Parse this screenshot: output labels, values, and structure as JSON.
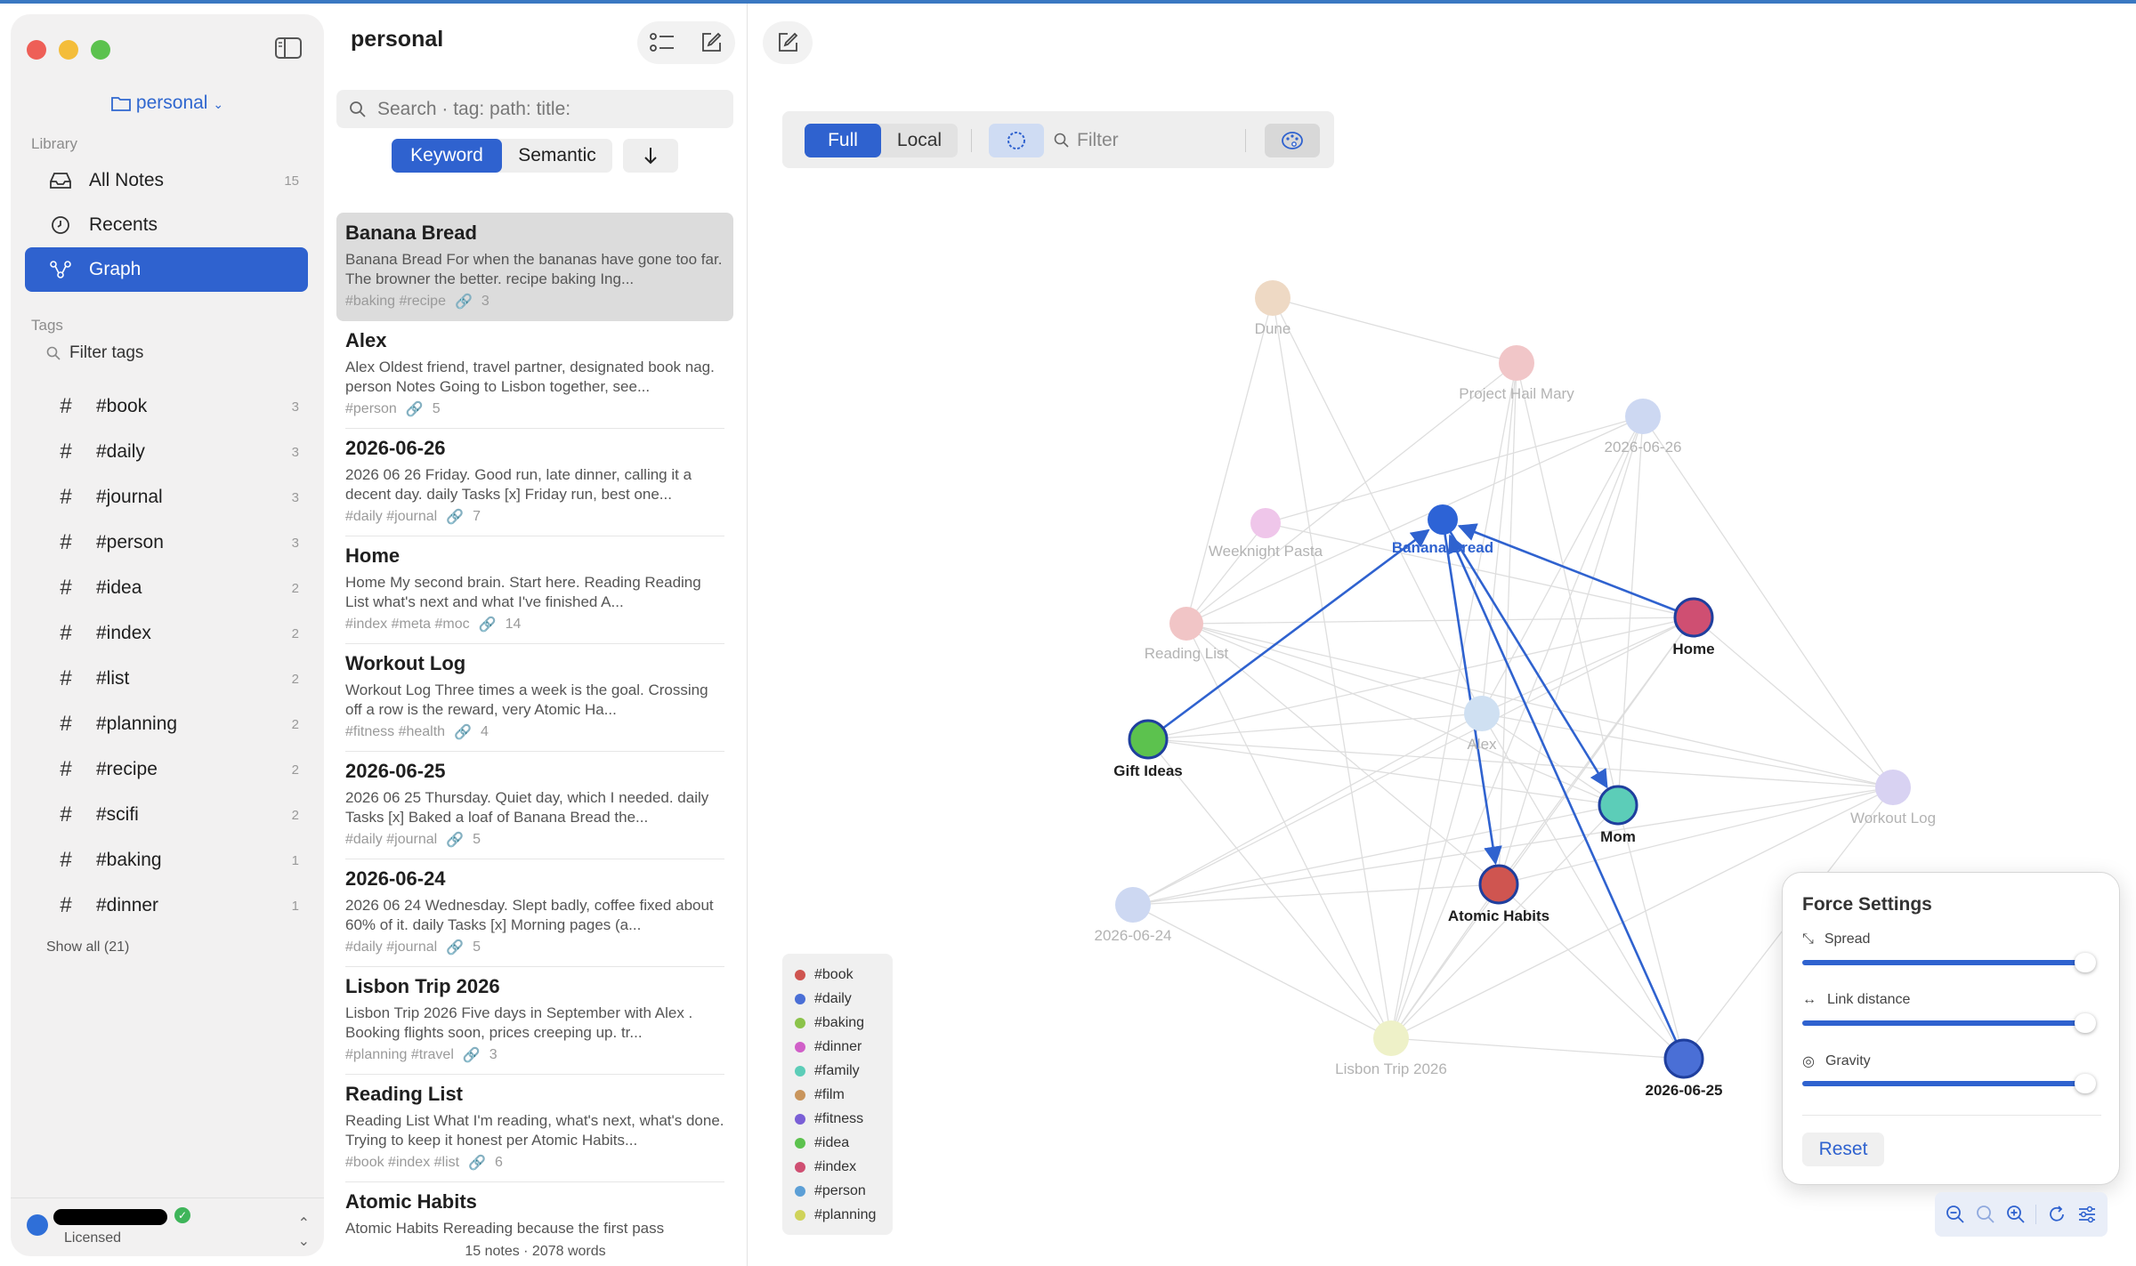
{
  "sidebar": {
    "vault_name": "personal",
    "library_label": "Library",
    "nav": [
      {
        "label": "All Notes",
        "count": "15",
        "icon": "tray-icon"
      },
      {
        "label": "Recents",
        "count": "",
        "icon": "clock-icon"
      },
      {
        "label": "Graph",
        "count": "",
        "icon": "graph-icon",
        "active": true
      }
    ],
    "tags_label": "Tags",
    "filter_tags_label": "Filter tags",
    "tags": [
      {
        "label": "#book",
        "count": "3"
      },
      {
        "label": "#daily",
        "count": "3"
      },
      {
        "label": "#journal",
        "count": "3"
      },
      {
        "label": "#person",
        "count": "3"
      },
      {
        "label": "#idea",
        "count": "2"
      },
      {
        "label": "#index",
        "count": "2"
      },
      {
        "label": "#list",
        "count": "2"
      },
      {
        "label": "#planning",
        "count": "2"
      },
      {
        "label": "#recipe",
        "count": "2"
      },
      {
        "label": "#scifi",
        "count": "2"
      },
      {
        "label": "#baking",
        "count": "1"
      },
      {
        "label": "#dinner",
        "count": "1"
      }
    ],
    "show_all": "Show all (21)",
    "footer": {
      "license": "Licensed"
    }
  },
  "notelist": {
    "title": "personal",
    "search_placeholder": "Search  ·  tag: path: title:",
    "modes": [
      "Keyword",
      "Semantic"
    ],
    "active_mode": "Keyword",
    "notes": [
      {
        "title": "Banana Bread",
        "excerpt": "Banana Bread For when the bananas have gone too far. The browner the better. recipe baking Ing...",
        "tags": "#baking #recipe",
        "links": "3",
        "selected": true
      },
      {
        "title": "Alex",
        "excerpt": "Alex Oldest friend, travel partner, designated book nag. person Notes Going to Lisbon together, see...",
        "tags": "#person",
        "links": "5"
      },
      {
        "title": "2026-06-26",
        "excerpt": "2026 06 26 Friday. Good run, late dinner, calling it a decent day. daily Tasks [x] Friday run, best one...",
        "tags": "#daily #journal",
        "links": "7"
      },
      {
        "title": "Home",
        "excerpt": "Home My second brain. Start here. Reading Reading List what's next and what I've finished A...",
        "tags": "#index #meta #moc",
        "links": "14"
      },
      {
        "title": "Workout Log",
        "excerpt": "Workout Log Three times a week is the goal. Crossing off a row is the reward, very Atomic Ha...",
        "tags": "#fitness #health",
        "links": "4"
      },
      {
        "title": "2026-06-25",
        "excerpt": "2026 06 25 Thursday. Quiet day, which I needed. daily Tasks [x] Baked a loaf of Banana Bread the...",
        "tags": "#daily #journal",
        "links": "5"
      },
      {
        "title": "2026-06-24",
        "excerpt": "2026 06 24 Wednesday. Slept badly, coffee fixed about 60% of it. daily Tasks [x] Morning pages (a...",
        "tags": "#daily #journal",
        "links": "5"
      },
      {
        "title": "Lisbon Trip 2026",
        "excerpt": "Lisbon Trip 2026 Five days in September with Alex . Booking flights soon, prices creeping up. tr...",
        "tags": "#planning #travel",
        "links": "3"
      },
      {
        "title": "Reading List",
        "excerpt": "Reading List What I'm reading, what's next, what's done. Trying to keep it honest per Atomic Habits...",
        "tags": "#book #index #list",
        "links": "6"
      },
      {
        "title": "Atomic Habits",
        "excerpt": "Atomic Habits Rereading because the first pass",
        "tags": "",
        "links": ""
      }
    ],
    "footer": "15 notes  ·  2078 words"
  },
  "graph": {
    "scope_options": [
      "Full",
      "Local"
    ],
    "active_scope": "Full",
    "filter_placeholder": "Filter",
    "nodes": [
      {
        "label": "Dune",
        "color": "#eed9c4",
        "faded": true
      },
      {
        "label": "Project Hail Mary",
        "color": "#f1c6c8",
        "faded": true
      },
      {
        "label": "2026-06-26",
        "color": "#cdd8f2",
        "faded": true
      },
      {
        "label": "Weeknight Pasta",
        "color": "#efc6ea",
        "faded": true
      },
      {
        "label": "Banana Bread",
        "color": "#2d63d6",
        "faded": false,
        "current": true
      },
      {
        "label": "Home",
        "color": "#cf4f72",
        "faded": false
      },
      {
        "label": "Reading List",
        "color": "#f1c5c6",
        "faded": true
      },
      {
        "label": "Alex",
        "color": "#cfe0f2",
        "faded": true
      },
      {
        "label": "Gift Ideas",
        "color": "#5cc24e",
        "faded": false
      },
      {
        "label": "Mom",
        "color": "#5ccdb8",
        "faded": false
      },
      {
        "label": "Workout Log",
        "color": "#d8d2f2",
        "faded": true
      },
      {
        "label": "Atomic Habits",
        "color": "#cf5550",
        "faded": false
      },
      {
        "label": "2026-06-24",
        "color": "#cdd8f2",
        "faded": true
      },
      {
        "label": "Lisbon Trip 2026",
        "color": "#eef1c8",
        "faded": true
      },
      {
        "label": "2026-06-25",
        "color": "#4a6fd6",
        "faded": false
      }
    ],
    "legend": [
      {
        "label": "#book",
        "color": "#cf5550"
      },
      {
        "label": "#daily",
        "color": "#4a6fd6"
      },
      {
        "label": "#baking",
        "color": "#8bc34a"
      },
      {
        "label": "#dinner",
        "color": "#d05fc8"
      },
      {
        "label": "#family",
        "color": "#5ccdb8"
      },
      {
        "label": "#film",
        "color": "#c9955c"
      },
      {
        "label": "#fitness",
        "color": "#7a5fd6"
      },
      {
        "label": "#idea",
        "color": "#5cc24e"
      },
      {
        "label": "#index",
        "color": "#cf4f72"
      },
      {
        "label": "#person",
        "color": "#5c9fd6"
      },
      {
        "label": "#planning",
        "color": "#cfd35a"
      }
    ],
    "force_settings": {
      "title": "Force Settings",
      "sliders": [
        {
          "label": "Spread",
          "value": 1.0,
          "icon": "expand-icon"
        },
        {
          "label": "Link distance",
          "value": 1.0,
          "icon": "arrows-horizontal-icon"
        },
        {
          "label": "Gravity",
          "value": 1.0,
          "icon": "target-icon"
        }
      ],
      "reset_label": "Reset"
    }
  }
}
